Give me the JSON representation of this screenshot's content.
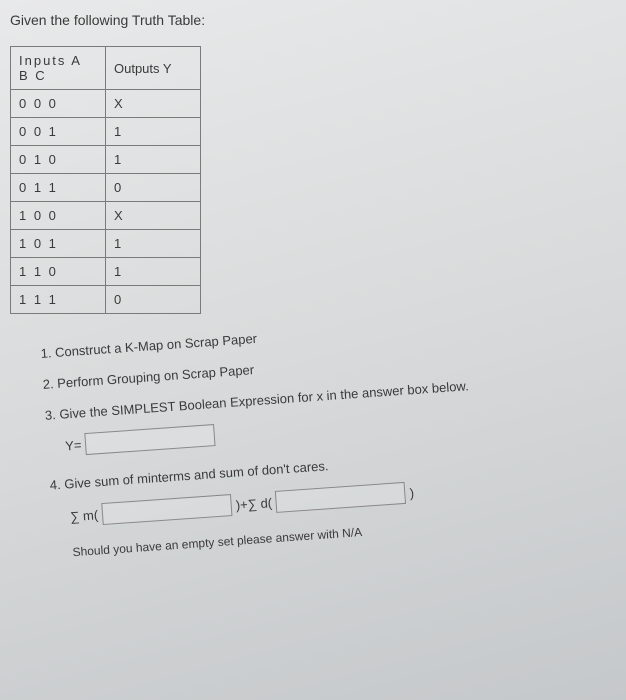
{
  "title": "Given the following Truth Table:",
  "table": {
    "header_inputs": "Inputs  A B C",
    "header_outputs": "Outputs     Y",
    "rows": [
      {
        "inputs": "0 0 0",
        "outputs": "X"
      },
      {
        "inputs": "0 0 1",
        "outputs": "1"
      },
      {
        "inputs": "0 1 0",
        "outputs": "1"
      },
      {
        "inputs": "0 1 1",
        "outputs": "0"
      },
      {
        "inputs": "1 0 0",
        "outputs": "X"
      },
      {
        "inputs": "1 0 1",
        "outputs": "1"
      },
      {
        "inputs": "1 1 0",
        "outputs": "1"
      },
      {
        "inputs": "1 1 1",
        "outputs": "0"
      }
    ]
  },
  "instructions": {
    "step1": "1. Construct a K-Map on Scrap Paper",
    "step2": "2. Perform Grouping on Scrap Paper",
    "step3": "3. Give the SIMPLEST Boolean Expression for x in the answer box below.",
    "step4": "4. Give sum of minterms and sum of don't cares."
  },
  "labels": {
    "y_equals": "Y=",
    "sigma_m": "∑ m(",
    "plus_sigma_d": ")+∑ d(",
    "close_paren": ")"
  },
  "note": "Should you have an empty set please answer with N/A"
}
